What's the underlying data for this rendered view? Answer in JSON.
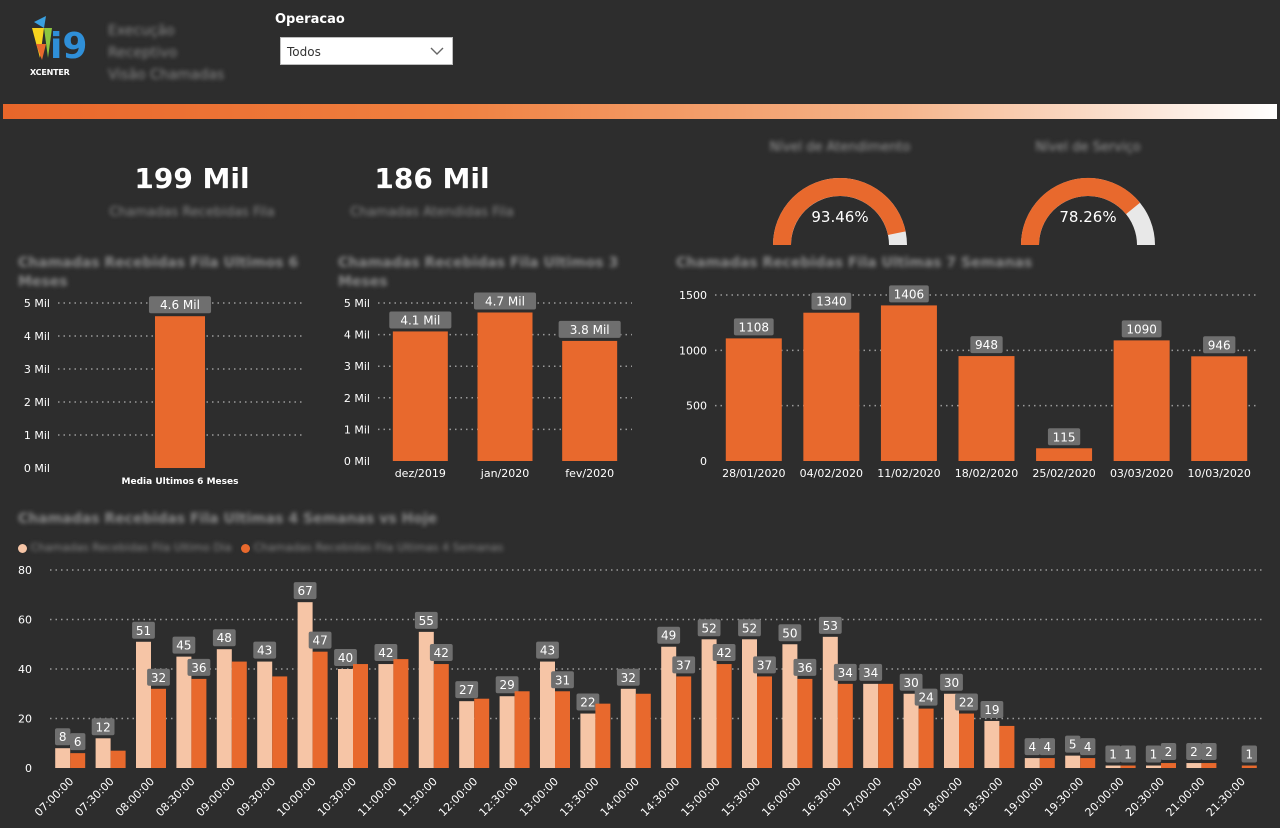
{
  "header": {
    "logo_text": "XCENTER",
    "lines": [
      "Execução",
      "Receptivo",
      "Visão Chamadas"
    ],
    "filter_label": "Operacao",
    "filter_value": "Todos"
  },
  "kpis": [
    {
      "value": "199 Mil",
      "label": "Chamadas Recebidas Fila"
    },
    {
      "value": "186 Mil",
      "label": "Chamadas Atendidas Fila"
    }
  ],
  "gauges": [
    {
      "title": "Nível de Atendimento",
      "value_label": "93.46%",
      "value": 0.9346
    },
    {
      "title": "Nível de Serviço",
      "value_label": "78.26%",
      "value": 0.7826
    }
  ],
  "colors": {
    "accent": "#e8692d",
    "accent_light": "#f6c5a6",
    "background": "#2d2d2d",
    "gauge_track": "#e8e8e8",
    "label_box": "#6f6f6f"
  },
  "chart_data": [
    {
      "id": "chart1",
      "type": "bar",
      "title": "Chamadas Recebidas Fila Ultimos 6 Meses",
      "categories": [
        "Media Ultimos 6 Meses"
      ],
      "values": [
        4.6
      ],
      "data_labels": [
        "4.6 Mil"
      ],
      "yticks": [
        "0 Mil",
        "1 Mil",
        "2 Mil",
        "3 Mil",
        "4 Mil",
        "5 Mil"
      ],
      "ylim": [
        0,
        5
      ]
    },
    {
      "id": "chart2",
      "type": "bar",
      "title": "Chamadas Recebidas Fila Ultimos 3 Meses",
      "categories": [
        "dez/2019",
        "jan/2020",
        "fev/2020"
      ],
      "values": [
        4.1,
        4.7,
        3.8
      ],
      "data_labels": [
        "4.1 Mil",
        "4.7 Mil",
        "3.8 Mil"
      ],
      "yticks": [
        "0 Mil",
        "1 Mil",
        "2 Mil",
        "3 Mil",
        "4 Mil",
        "5 Mil"
      ],
      "ylim": [
        0,
        5
      ]
    },
    {
      "id": "chart3",
      "type": "bar",
      "title": "Chamadas Recebidas Fila Ultimas 7 Semanas",
      "categories": [
        "28/01/2020",
        "04/02/2020",
        "11/02/2020",
        "18/02/2020",
        "25/02/2020",
        "03/03/2020",
        "10/03/2020"
      ],
      "values": [
        1108,
        1340,
        1406,
        948,
        115,
        1090,
        946
      ],
      "data_labels": [
        "1108",
        "1340",
        "1406",
        "948",
        "115",
        "1090",
        "946"
      ],
      "yticks": [
        "0",
        "500",
        "1000",
        "1500"
      ],
      "ylim": [
        0,
        1500
      ]
    },
    {
      "id": "chart4",
      "type": "bar",
      "title": "Chamadas Recebidas Fila Ultimas 4 Semanas vs Hoje",
      "legend": [
        "Chamadas Recebidas Fila Ultimo Dia",
        "Chamadas Recebidas Fila Ultimas 4 Semanas"
      ],
      "categories": [
        "07:00:00",
        "07:30:00",
        "08:00:00",
        "08:30:00",
        "09:00:00",
        "09:30:00",
        "10:00:00",
        "10:30:00",
        "11:00:00",
        "11:30:00",
        "12:00:00",
        "12:30:00",
        "13:00:00",
        "13:30:00",
        "14:00:00",
        "14:30:00",
        "15:00:00",
        "15:30:00",
        "16:00:00",
        "16:30:00",
        "17:00:00",
        "17:30:00",
        "18:00:00",
        "18:30:00",
        "19:00:00",
        "19:30:00",
        "20:00:00",
        "20:30:00",
        "21:00:00",
        "21:30:00"
      ],
      "series": [
        {
          "name": "Chamadas Recebidas Fila Ultimo Dia",
          "values": [
            8,
            12,
            51,
            45,
            48,
            43,
            67,
            40,
            42,
            55,
            27,
            29,
            43,
            22,
            32,
            49,
            52,
            52,
            50,
            53,
            34,
            30,
            30,
            19,
            4,
            5,
            1,
            1,
            2,
            0
          ],
          "labels": [
            "8",
            "12",
            "51",
            "45",
            "48",
            "43",
            "67",
            "40",
            "42",
            "55",
            "27",
            "29",
            "43",
            "22",
            "32",
            "49",
            "52",
            "52",
            "50",
            "53",
            "34",
            "30",
            "30",
            "19",
            "4",
            "5",
            "1",
            "1",
            "2",
            ""
          ]
        },
        {
          "name": "Chamadas Recebidas Fila Ultimas 4 Semanas",
          "values": [
            6,
            7,
            32,
            36,
            43,
            37,
            47,
            42,
            44,
            42,
            28,
            31,
            31,
            26,
            30,
            37,
            42,
            37,
            36,
            34,
            34,
            24,
            22,
            17,
            4,
            4,
            1,
            2,
            2,
            1
          ],
          "labels": [
            "6",
            "",
            "32",
            "36",
            "",
            "",
            "47",
            "",
            "",
            "42",
            "",
            "",
            "31",
            "",
            "",
            "37",
            "42",
            "37",
            "36",
            "34",
            "",
            "24",
            "22",
            "",
            "4",
            "4",
            "1",
            "2",
            "2",
            "1"
          ]
        }
      ],
      "yticks": [
        "0",
        "20",
        "40",
        "60",
        "80"
      ],
      "ylim": [
        0,
        80
      ]
    }
  ]
}
